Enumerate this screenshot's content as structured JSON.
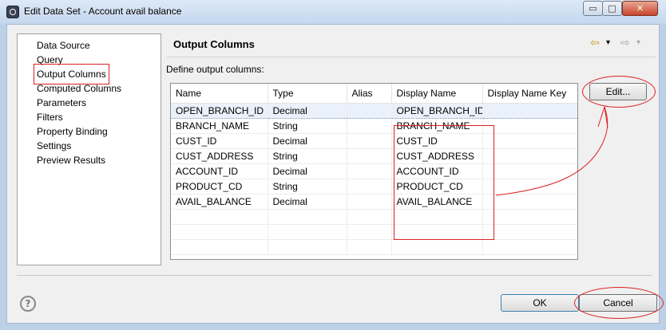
{
  "window": {
    "title": "Edit Data Set - Account avail balance",
    "minimize_glyph": "▭",
    "maximize_glyph": "□",
    "close_glyph": "✕"
  },
  "nav": {
    "items": [
      {
        "label": "Data Source"
      },
      {
        "label": "Query"
      },
      {
        "label": "Output Columns"
      },
      {
        "label": "Computed Columns"
      },
      {
        "label": "Parameters"
      },
      {
        "label": "Filters"
      },
      {
        "label": "Property Binding"
      },
      {
        "label": "Settings"
      },
      {
        "label": "Preview Results"
      }
    ],
    "selected": "Output Columns"
  },
  "page": {
    "title": "Output Columns",
    "define_label": "Define output columns:",
    "back_glyph": "⇦",
    "forward_glyph": "⇨",
    "dropdown_glyph": "▾"
  },
  "table": {
    "headers": [
      "Name",
      "Type",
      "Alias",
      "Display Name",
      "Display Name Key"
    ],
    "rows": [
      [
        "OPEN_BRANCH_ID",
        "Decimal",
        "",
        "OPEN_BRANCH_ID",
        ""
      ],
      [
        "BRANCH_NAME",
        "String",
        "",
        "BRANCH_NAME",
        ""
      ],
      [
        "CUST_ID",
        "Decimal",
        "",
        "CUST_ID",
        ""
      ],
      [
        "CUST_ADDRESS",
        "String",
        "",
        "CUST_ADDRESS",
        ""
      ],
      [
        "ACCOUNT_ID",
        "Decimal",
        "",
        "ACCOUNT_ID",
        ""
      ],
      [
        "PRODUCT_CD",
        "String",
        "",
        "PRODUCT_CD",
        ""
      ],
      [
        "AVAIL_BALANCE",
        "Decimal",
        "",
        "AVAIL_BALANCE",
        ""
      ]
    ]
  },
  "buttons": {
    "edit": "Edit...",
    "ok": "OK",
    "cancel": "Cancel",
    "help_glyph": "?"
  },
  "colors": {
    "annotation": "#dd2222",
    "selection": "#eaf1fb"
  }
}
